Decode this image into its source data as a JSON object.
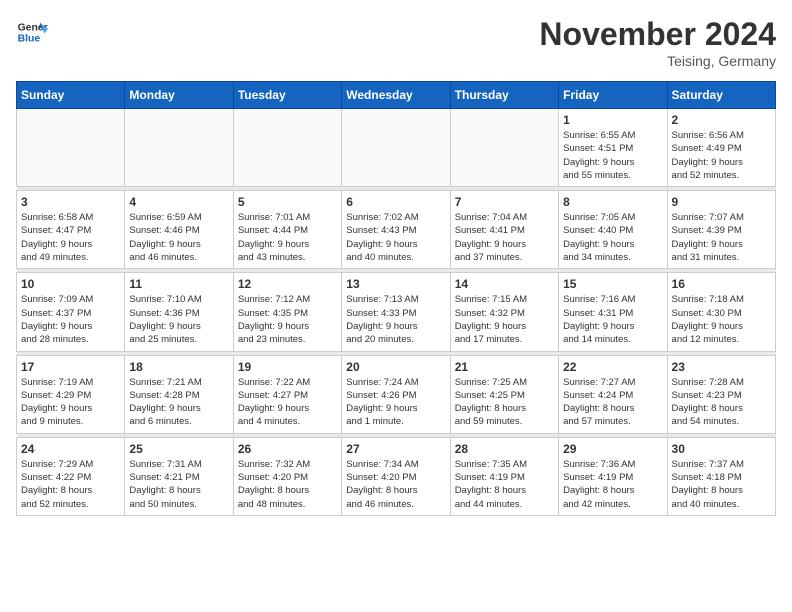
{
  "logo": {
    "line1": "General",
    "line2": "Blue"
  },
  "title": "November 2024",
  "location": "Teising, Germany",
  "days_header": [
    "Sunday",
    "Monday",
    "Tuesday",
    "Wednesday",
    "Thursday",
    "Friday",
    "Saturday"
  ],
  "weeks": [
    [
      {
        "day": "",
        "info": ""
      },
      {
        "day": "",
        "info": ""
      },
      {
        "day": "",
        "info": ""
      },
      {
        "day": "",
        "info": ""
      },
      {
        "day": "",
        "info": ""
      },
      {
        "day": "1",
        "info": "Sunrise: 6:55 AM\nSunset: 4:51 PM\nDaylight: 9 hours\nand 55 minutes."
      },
      {
        "day": "2",
        "info": "Sunrise: 6:56 AM\nSunset: 4:49 PM\nDaylight: 9 hours\nand 52 minutes."
      }
    ],
    [
      {
        "day": "3",
        "info": "Sunrise: 6:58 AM\nSunset: 4:47 PM\nDaylight: 9 hours\nand 49 minutes."
      },
      {
        "day": "4",
        "info": "Sunrise: 6:59 AM\nSunset: 4:46 PM\nDaylight: 9 hours\nand 46 minutes."
      },
      {
        "day": "5",
        "info": "Sunrise: 7:01 AM\nSunset: 4:44 PM\nDaylight: 9 hours\nand 43 minutes."
      },
      {
        "day": "6",
        "info": "Sunrise: 7:02 AM\nSunset: 4:43 PM\nDaylight: 9 hours\nand 40 minutes."
      },
      {
        "day": "7",
        "info": "Sunrise: 7:04 AM\nSunset: 4:41 PM\nDaylight: 9 hours\nand 37 minutes."
      },
      {
        "day": "8",
        "info": "Sunrise: 7:05 AM\nSunset: 4:40 PM\nDaylight: 9 hours\nand 34 minutes."
      },
      {
        "day": "9",
        "info": "Sunrise: 7:07 AM\nSunset: 4:39 PM\nDaylight: 9 hours\nand 31 minutes."
      }
    ],
    [
      {
        "day": "10",
        "info": "Sunrise: 7:09 AM\nSunset: 4:37 PM\nDaylight: 9 hours\nand 28 minutes."
      },
      {
        "day": "11",
        "info": "Sunrise: 7:10 AM\nSunset: 4:36 PM\nDaylight: 9 hours\nand 25 minutes."
      },
      {
        "day": "12",
        "info": "Sunrise: 7:12 AM\nSunset: 4:35 PM\nDaylight: 9 hours\nand 23 minutes."
      },
      {
        "day": "13",
        "info": "Sunrise: 7:13 AM\nSunset: 4:33 PM\nDaylight: 9 hours\nand 20 minutes."
      },
      {
        "day": "14",
        "info": "Sunrise: 7:15 AM\nSunset: 4:32 PM\nDaylight: 9 hours\nand 17 minutes."
      },
      {
        "day": "15",
        "info": "Sunrise: 7:16 AM\nSunset: 4:31 PM\nDaylight: 9 hours\nand 14 minutes."
      },
      {
        "day": "16",
        "info": "Sunrise: 7:18 AM\nSunset: 4:30 PM\nDaylight: 9 hours\nand 12 minutes."
      }
    ],
    [
      {
        "day": "17",
        "info": "Sunrise: 7:19 AM\nSunset: 4:29 PM\nDaylight: 9 hours\nand 9 minutes."
      },
      {
        "day": "18",
        "info": "Sunrise: 7:21 AM\nSunset: 4:28 PM\nDaylight: 9 hours\nand 6 minutes."
      },
      {
        "day": "19",
        "info": "Sunrise: 7:22 AM\nSunset: 4:27 PM\nDaylight: 9 hours\nand 4 minutes."
      },
      {
        "day": "20",
        "info": "Sunrise: 7:24 AM\nSunset: 4:26 PM\nDaylight: 9 hours\nand 1 minute."
      },
      {
        "day": "21",
        "info": "Sunrise: 7:25 AM\nSunset: 4:25 PM\nDaylight: 8 hours\nand 59 minutes."
      },
      {
        "day": "22",
        "info": "Sunrise: 7:27 AM\nSunset: 4:24 PM\nDaylight: 8 hours\nand 57 minutes."
      },
      {
        "day": "23",
        "info": "Sunrise: 7:28 AM\nSunset: 4:23 PM\nDaylight: 8 hours\nand 54 minutes."
      }
    ],
    [
      {
        "day": "24",
        "info": "Sunrise: 7:29 AM\nSunset: 4:22 PM\nDaylight: 8 hours\nand 52 minutes."
      },
      {
        "day": "25",
        "info": "Sunrise: 7:31 AM\nSunset: 4:21 PM\nDaylight: 8 hours\nand 50 minutes."
      },
      {
        "day": "26",
        "info": "Sunrise: 7:32 AM\nSunset: 4:20 PM\nDaylight: 8 hours\nand 48 minutes."
      },
      {
        "day": "27",
        "info": "Sunrise: 7:34 AM\nSunset: 4:20 PM\nDaylight: 8 hours\nand 46 minutes."
      },
      {
        "day": "28",
        "info": "Sunrise: 7:35 AM\nSunset: 4:19 PM\nDaylight: 8 hours\nand 44 minutes."
      },
      {
        "day": "29",
        "info": "Sunrise: 7:36 AM\nSunset: 4:19 PM\nDaylight: 8 hours\nand 42 minutes."
      },
      {
        "day": "30",
        "info": "Sunrise: 7:37 AM\nSunset: 4:18 PM\nDaylight: 8 hours\nand 40 minutes."
      }
    ]
  ]
}
